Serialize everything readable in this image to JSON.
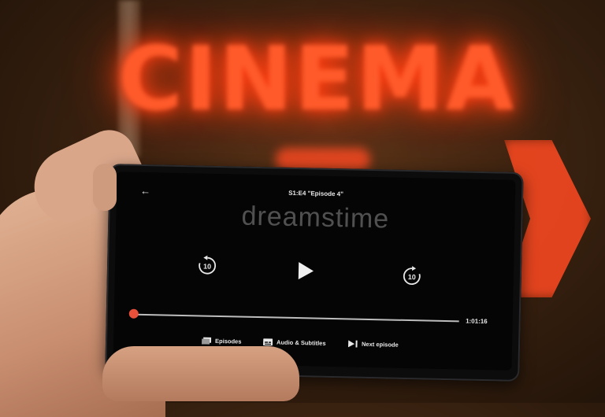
{
  "sign": {
    "text": "CINEMA"
  },
  "player": {
    "episode_title": "S1:E4 \"Episode 4\"",
    "watermark": "dreamstime",
    "time_remaining": "1:01:16",
    "progress": 0.0,
    "rewind_seconds": "10",
    "forward_seconds": "10",
    "bottom_bar": {
      "episodes_label": "Episodes",
      "audio_label": "Audio & Subtitles",
      "next_label": "Next episode"
    },
    "icons": {
      "back": "arrow-left-icon",
      "play": "play-icon",
      "rewind": "rewind-10-icon",
      "forward": "forward-10-icon",
      "episodes": "episodes-icon",
      "audio": "subtitles-icon",
      "next": "next-episode-icon"
    },
    "accent": "#e8503a"
  }
}
